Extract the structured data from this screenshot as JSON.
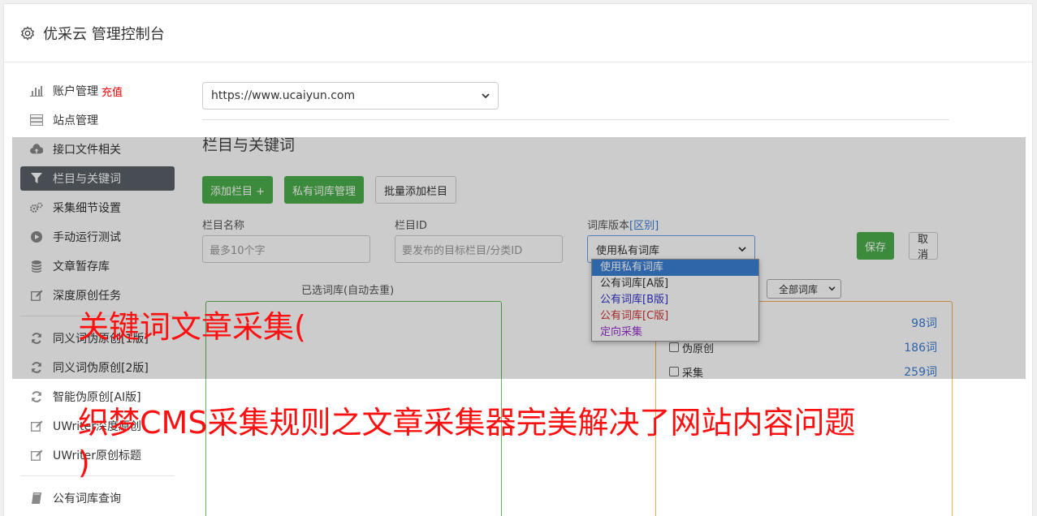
{
  "header": {
    "title": "优采云 管理控制台"
  },
  "sidebar": {
    "group1": [
      {
        "label": "账户管理",
        "badge": "充值",
        "icon": "bar-chart-icon"
      },
      {
        "label": "站点管理",
        "icon": "server-icon"
      },
      {
        "label": "接口文件相关",
        "icon": "cloud-upload-icon"
      },
      {
        "label": "栏目与关键词",
        "icon": "filter-icon",
        "active": true
      },
      {
        "label": "采集细节设置",
        "icon": "cogs-icon"
      },
      {
        "label": "手动运行测试",
        "icon": "play-circle-icon"
      },
      {
        "label": "文章暂存库",
        "icon": "database-icon"
      },
      {
        "label": "深度原创任务",
        "icon": "edit-icon"
      }
    ],
    "group2": [
      {
        "label": "同义词伪原创[1版]",
        "icon": "refresh-icon"
      },
      {
        "label": "同义词伪原创[2版]",
        "icon": "refresh-icon"
      },
      {
        "label": "智能伪原创[AI版]",
        "icon": "refresh-icon"
      },
      {
        "label": "UWriter深度原创",
        "icon": "edit-icon"
      },
      {
        "label": "UWriter原创标题",
        "icon": "edit-icon"
      }
    ],
    "group3": [
      {
        "label": "公有词库查询",
        "icon": "book-icon"
      }
    ]
  },
  "main": {
    "site_select": "https://www.ucaiyun.com",
    "section_title": "栏目与关键词",
    "buttons": {
      "add": "添加栏目 +",
      "private_lib": "私有词库管理",
      "batch_add": "批量添加栏目"
    },
    "form": {
      "name_label": "栏目名称",
      "name_placeholder": "最多10个字",
      "id_label": "栏目ID",
      "id_placeholder": "要发布的目标栏目/分类ID",
      "version_label": "词库版本",
      "version_link": "[区别]",
      "version_value": "使用私有词库",
      "save": "保存",
      "cancel": "取消"
    },
    "dropdown_options": [
      {
        "label": "使用私有词库",
        "color": "#ffffff"
      },
      {
        "label": "公有词库[A版]",
        "color": "#333333"
      },
      {
        "label": "公有词库[B版]",
        "color": "#3333cc"
      },
      {
        "label": "公有词库[C版]",
        "color": "#cc3333"
      },
      {
        "label": "定向采集",
        "color": "#9933cc"
      }
    ],
    "selected_label": "已选词库(自动去重)",
    "lib_filter": "全部词库",
    "libs": [
      {
        "label": "",
        "count": "98词"
      },
      {
        "label": "伪原创",
        "count": "186词"
      },
      {
        "label": "采集",
        "count": "259词"
      }
    ]
  },
  "overlay": {
    "line1": "关键词文章采集(",
    "line2": "织梦CMS采集规则之文章采集器完美解决了网站内容问题",
    "line3": ")"
  }
}
